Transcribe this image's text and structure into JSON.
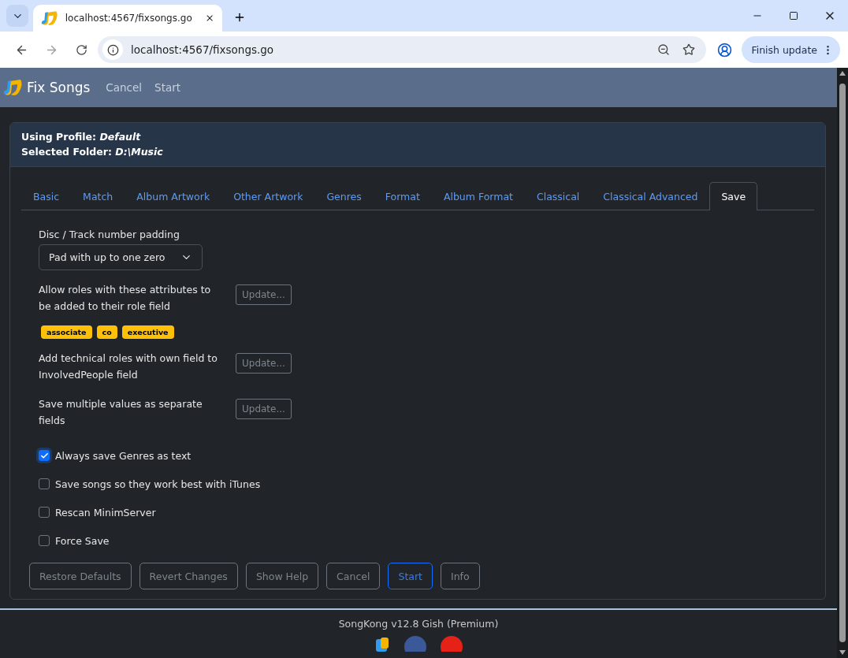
{
  "browser": {
    "tab_title": "localhost:4567/fixsongs.go",
    "url": "localhost:4567/fixsongs.go",
    "update_button": "Finish update"
  },
  "navbar": {
    "title": "Fix Songs",
    "links": [
      "Cancel",
      "Start"
    ]
  },
  "card_header": {
    "profile_label": "Using Profile:",
    "profile": "Default",
    "folder_label": "Selected Folder:",
    "folder": "D:\\Music"
  },
  "tabs": [
    {
      "label": "Basic",
      "selected": false
    },
    {
      "label": "Match",
      "selected": false
    },
    {
      "label": "Album Artwork",
      "selected": false
    },
    {
      "label": "Other Artwork",
      "selected": false
    },
    {
      "label": "Genres",
      "selected": false
    },
    {
      "label": "Format",
      "selected": false
    },
    {
      "label": "Album Format",
      "selected": false
    },
    {
      "label": "Classical",
      "selected": false
    },
    {
      "label": "Classical Advanced",
      "selected": false
    },
    {
      "label": "Save",
      "selected": true
    }
  ],
  "padding": {
    "label": "Disc / Track number padding",
    "value": "Pad with up to one zero"
  },
  "settings": [
    {
      "kind": "update",
      "label": "Allow roles with these attributes to be added to their role field",
      "button": "Update...",
      "tags": [
        "associate",
        "co",
        "executive"
      ]
    },
    {
      "kind": "update",
      "label": "Add technical roles with own field to InvolvedPeople field",
      "button": "Update..."
    },
    {
      "kind": "update",
      "label": "Save multiple values as separate fields",
      "button": "Update..."
    },
    {
      "kind": "checkbox",
      "label": "Always save Genres as text",
      "checked": true
    },
    {
      "kind": "checkbox",
      "label": "Save songs so they work best with iTunes",
      "checked": false
    },
    {
      "kind": "checkbox",
      "label": "Rescan MinimServer",
      "checked": false
    },
    {
      "kind": "checkbox",
      "label": "Force Save",
      "checked": false
    }
  ],
  "actions": [
    {
      "label": "Restore Defaults",
      "kind": "secondary"
    },
    {
      "label": "Revert Changes",
      "kind": "secondary"
    },
    {
      "label": "Show Help",
      "kind": "secondary"
    },
    {
      "label": "Cancel",
      "kind": "secondary"
    },
    {
      "label": "Start",
      "kind": "primary"
    },
    {
      "label": "Info",
      "kind": "secondary"
    }
  ],
  "footer": {
    "text": "SongKong v12.8 Gish (Premium)"
  }
}
